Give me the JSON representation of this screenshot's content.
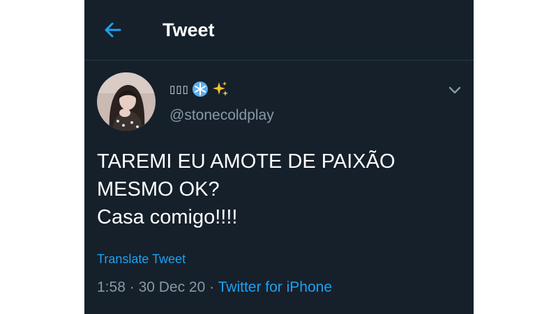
{
  "header": {
    "title": "Tweet",
    "back_icon": "arrow-left-icon"
  },
  "author": {
    "display_name": "▯▯▯",
    "emojis": [
      "snowflake-icon",
      "sparkles-icon"
    ],
    "handle": "@stonecoldplay",
    "menu_icon": "chevron-down-icon"
  },
  "tweet": {
    "lines": [
      "TAREMI EU AMOTE DE PAIXÃO",
      "MESMO OK?",
      "Casa comigo!!!!"
    ],
    "translate_label": "Translate Tweet",
    "time": "1:58",
    "separator": "·",
    "date": "30 Dec 20",
    "source": "Twitter for iPhone"
  },
  "colors": {
    "background": "#15202b",
    "accent": "#1da1f2",
    "secondary_text": "#8899a6",
    "divider": "#2c3945"
  }
}
